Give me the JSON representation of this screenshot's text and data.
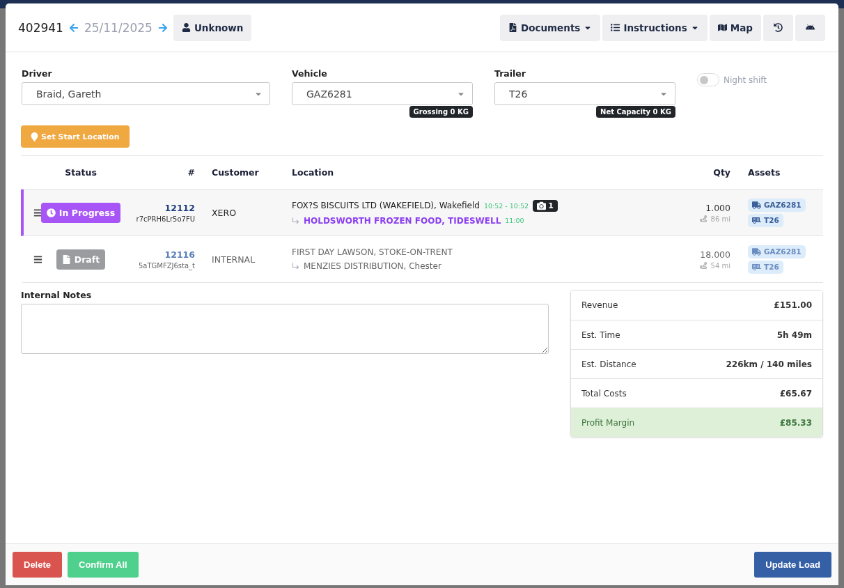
{
  "header": {
    "load_number": "402941",
    "date": "25/11/2025",
    "driver_button": "Unknown",
    "actions": [
      {
        "kind": "documents",
        "label": "Documents",
        "dropdown": true
      },
      {
        "kind": "instructions",
        "label": "Instructions",
        "dropdown": true
      },
      {
        "kind": "map",
        "label": "Map",
        "dropdown": false
      },
      {
        "kind": "history"
      },
      {
        "kind": "android"
      }
    ]
  },
  "fields": [
    {
      "label": "Driver",
      "value": "Braid, Gareth"
    },
    {
      "label": "Vehicle",
      "value": "GAZ6281",
      "tag": "Grossing 0 KG"
    },
    {
      "label": "Trailer",
      "value": "T26",
      "tag": "Net Capacity 0 KG"
    }
  ],
  "night_shift": {
    "label": "Night shift",
    "on": false
  },
  "set_start_location": "Set Start Location",
  "table": {
    "columns": [
      "Status",
      "#",
      "Customer",
      "Location",
      "Qty",
      "Assets"
    ],
    "rows": [
      {
        "status": {
          "kind": "in_progress",
          "label": "In Progress"
        },
        "number": "12112",
        "ref": "r7cPRH6Lr5o7FU",
        "customer": "XERO",
        "from": "FOX?S BISCUITS LTD (WAKEFIELD), Wakefield",
        "from_time": "10:52 - 10:52",
        "photos": "1",
        "to": "HOLDSWORTH FROZEN FOOD, TIDESWELL",
        "to_time": "11:00",
        "qty": "1.000",
        "distance": "86 mi",
        "assets": [
          {
            "kind": "vehicle",
            "label": "GAZ6281"
          },
          {
            "kind": "trailer",
            "label": "T26"
          }
        ]
      },
      {
        "status": {
          "kind": "draft",
          "label": "Draft"
        },
        "number": "12116",
        "ref": "5aTGMFZJ6sta_t",
        "customer": "INTERNAL",
        "from": "FIRST DAY LAWSON, STOKE-ON-TRENT",
        "to": "MENZIES DISTRIBUTION, Chester",
        "qty": "18.000",
        "distance": "54 mi",
        "assets": [
          {
            "kind": "vehicle",
            "label": "GAZ6281"
          },
          {
            "kind": "trailer",
            "label": "T26"
          }
        ]
      }
    ]
  },
  "internal_notes": {
    "label": "Internal Notes"
  },
  "summary": [
    {
      "label": "Revenue",
      "value": "£151.00"
    },
    {
      "label": "Est. Time",
      "value": "5h 49m"
    },
    {
      "label": "Est. Distance",
      "value": "226km / 140 miles"
    },
    {
      "label": "Total Costs",
      "value": "£65.67"
    },
    {
      "label": "Profit Margin",
      "value": "£85.33",
      "kind": "profit"
    }
  ],
  "footer": {
    "buttons": [
      {
        "kind": "danger",
        "label": "Delete"
      },
      {
        "kind": "success",
        "label": "Confirm All"
      },
      {
        "kind": "primary",
        "label": "Update Load"
      }
    ]
  }
}
